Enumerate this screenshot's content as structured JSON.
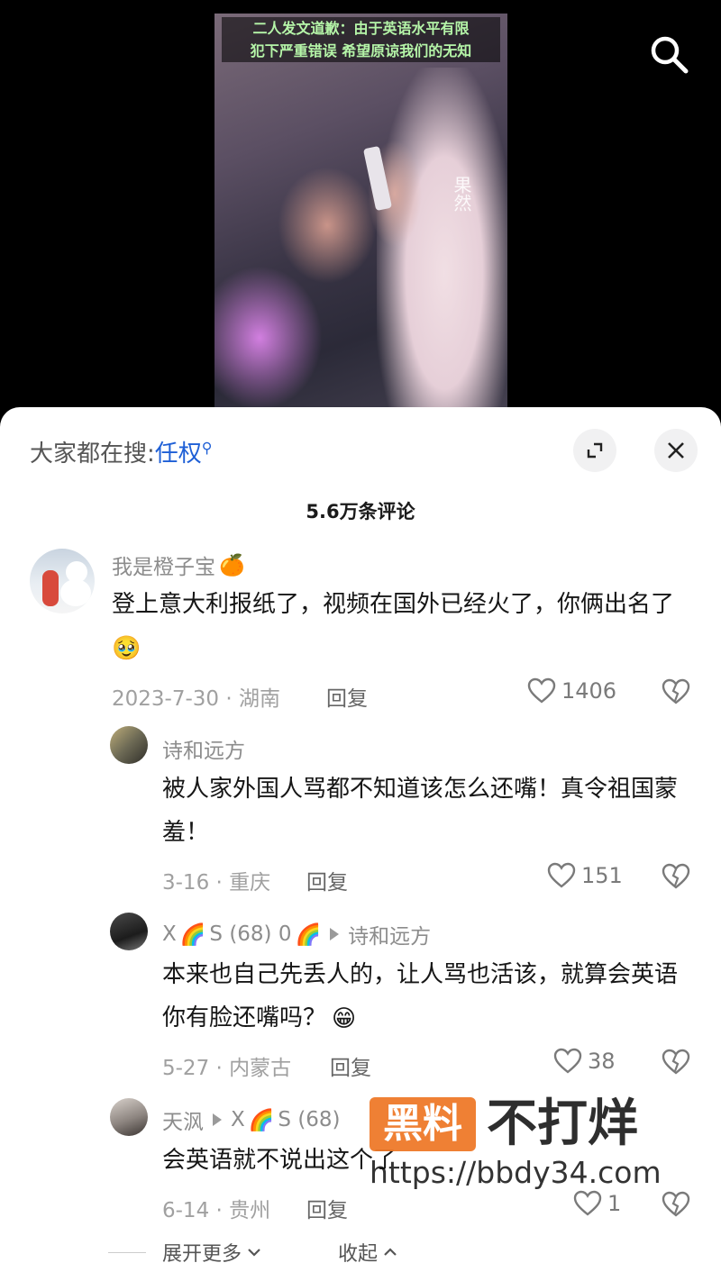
{
  "video": {
    "caption_line1": "二人发文道歉：由于英语水平有限",
    "caption_line2": "犯下严重错误 希望原谅我们的无知",
    "watermark": "果然"
  },
  "sheet": {
    "search_prefix": "大家都在搜:",
    "search_keyword": "任权",
    "comment_count": "5.6万条评论",
    "expand_label": "展开更多",
    "collapse_label": "收起"
  },
  "comments": [
    {
      "user": "我是橙子宝",
      "user_emoji": "🍊",
      "text": "登上意大利报纸了，视频在国外已经火了，你俩出名了",
      "text_emoji": "🥹",
      "date_loc": "2023-7-30 · 湖南",
      "reply_label": "回复",
      "likes": "1406"
    },
    {
      "user": "诗和远方",
      "text": "被人家外国人骂都不知道该怎么还嘴！真令祖国蒙羞！",
      "date_loc": "3-16 · 重庆",
      "reply_label": "回复",
      "likes": "151"
    },
    {
      "user_part1": "X",
      "user_part2": "S (68) 0",
      "reply_to": "诗和远方",
      "text": "本来也自己先丢人的，让人骂也活该，就算会英语你有脸还嘴吗？",
      "text_emoji": "😁",
      "date_loc": "5-27 · 内蒙古",
      "reply_label": "回复",
      "likes": "38"
    },
    {
      "user": "天沨",
      "reply_to_part1": "X",
      "reply_to_part2": "S (68)",
      "text": "会英语就不说出这个了",
      "date_loc": "6-14 · 贵州",
      "reply_label": "回复",
      "likes": "1"
    }
  ],
  "watermark": {
    "badge": "黑料",
    "title": "不打烊",
    "url": "https://bbdy34.com"
  },
  "colors": {
    "accent_blue": "#1e5fd6",
    "caption_green": "#b5f5a8",
    "watermark_orange": "#ef7a2a"
  }
}
